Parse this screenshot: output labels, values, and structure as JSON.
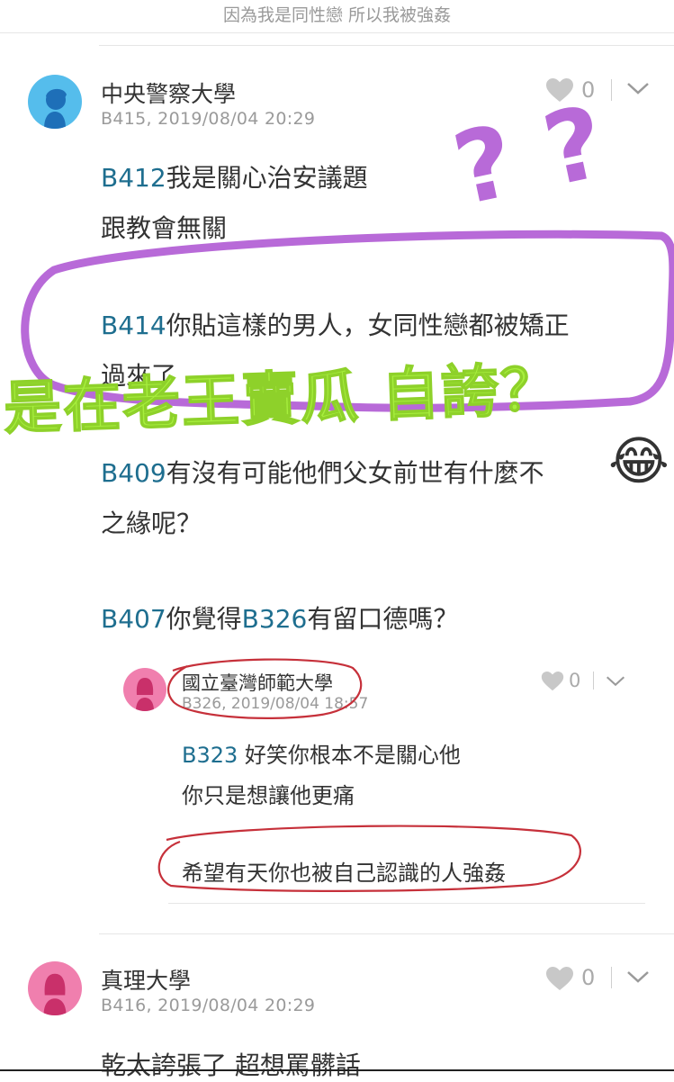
{
  "header": {
    "title": "因為我是同性戀 所以我被強姦"
  },
  "comments": [
    {
      "author": "中央警察大學",
      "meta": "B415, 2019/08/04 20:29",
      "likes": "0",
      "lines": [
        {
          "ref": "B412",
          "text": "我是關心治安議題"
        },
        {
          "text": "跟教會無關"
        },
        {
          "ref": "B414",
          "text": "你貼這樣的男人，女同性戀都被矯正"
        },
        {
          "text": "過來了"
        },
        {
          "ref": "B409",
          "text": "有沒有可能他們父女前世有什麼不"
        },
        {
          "text": "之緣呢？"
        },
        {
          "ref": "B407",
          "text": "你覺得",
          "ref2": "B326",
          "text2": "有留口德嗎？"
        }
      ],
      "quoted": {
        "author": "國立臺灣師範大學",
        "meta": "B326, 2019/08/04 18:57",
        "likes": "0",
        "lines": [
          {
            "ref": "B323",
            "text": " 好笑你根本不是關心他"
          },
          {
            "text": "你只是想讓他更痛"
          },
          {
            "text": "希望有天你也被自己認識的人強姦"
          }
        ]
      }
    },
    {
      "author": "真理大學",
      "meta": "B416, 2019/08/04 20:29",
      "likes": "0",
      "lines": [
        {
          "text": "乾太誇張了 超想罵髒話"
        }
      ]
    }
  ],
  "annotations": {
    "question_marks": "? ?",
    "overlay_text": "是在老王賣瓜 自誇？",
    "emoji": "😂",
    "colors": {
      "purple": "#b86ad8",
      "green": "#a7ef3d",
      "red": "#c6303a"
    }
  }
}
